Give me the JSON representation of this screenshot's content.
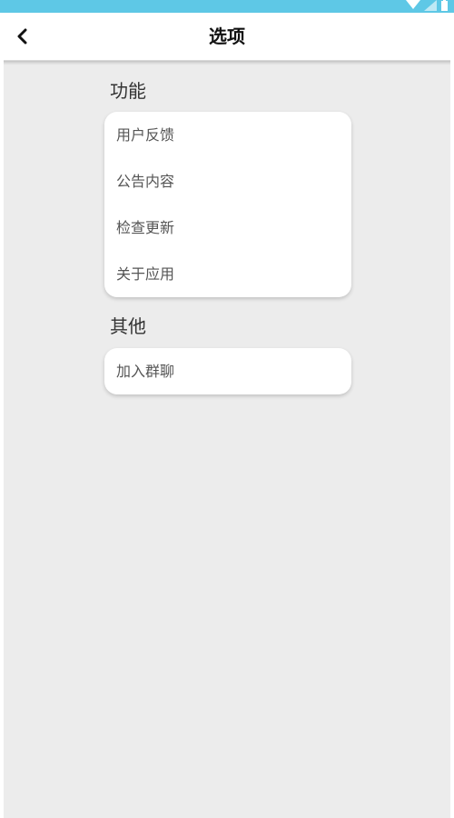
{
  "header": {
    "title": "选项",
    "back_icon": "chevron-left-icon"
  },
  "status_bar": {
    "color": "#5ec8e6",
    "icons": [
      "wifi-icon",
      "signal-icon",
      "battery-icon"
    ]
  },
  "sections": [
    {
      "title": "功能",
      "items": [
        {
          "label": "用户反馈"
        },
        {
          "label": "公告内容"
        },
        {
          "label": "检查更新"
        },
        {
          "label": "关于应用"
        }
      ]
    },
    {
      "title": "其他",
      "items": [
        {
          "label": "加入群聊"
        }
      ]
    }
  ],
  "colors": {
    "background": "#ececec",
    "card": "#ffffff",
    "text": "#555555"
  }
}
